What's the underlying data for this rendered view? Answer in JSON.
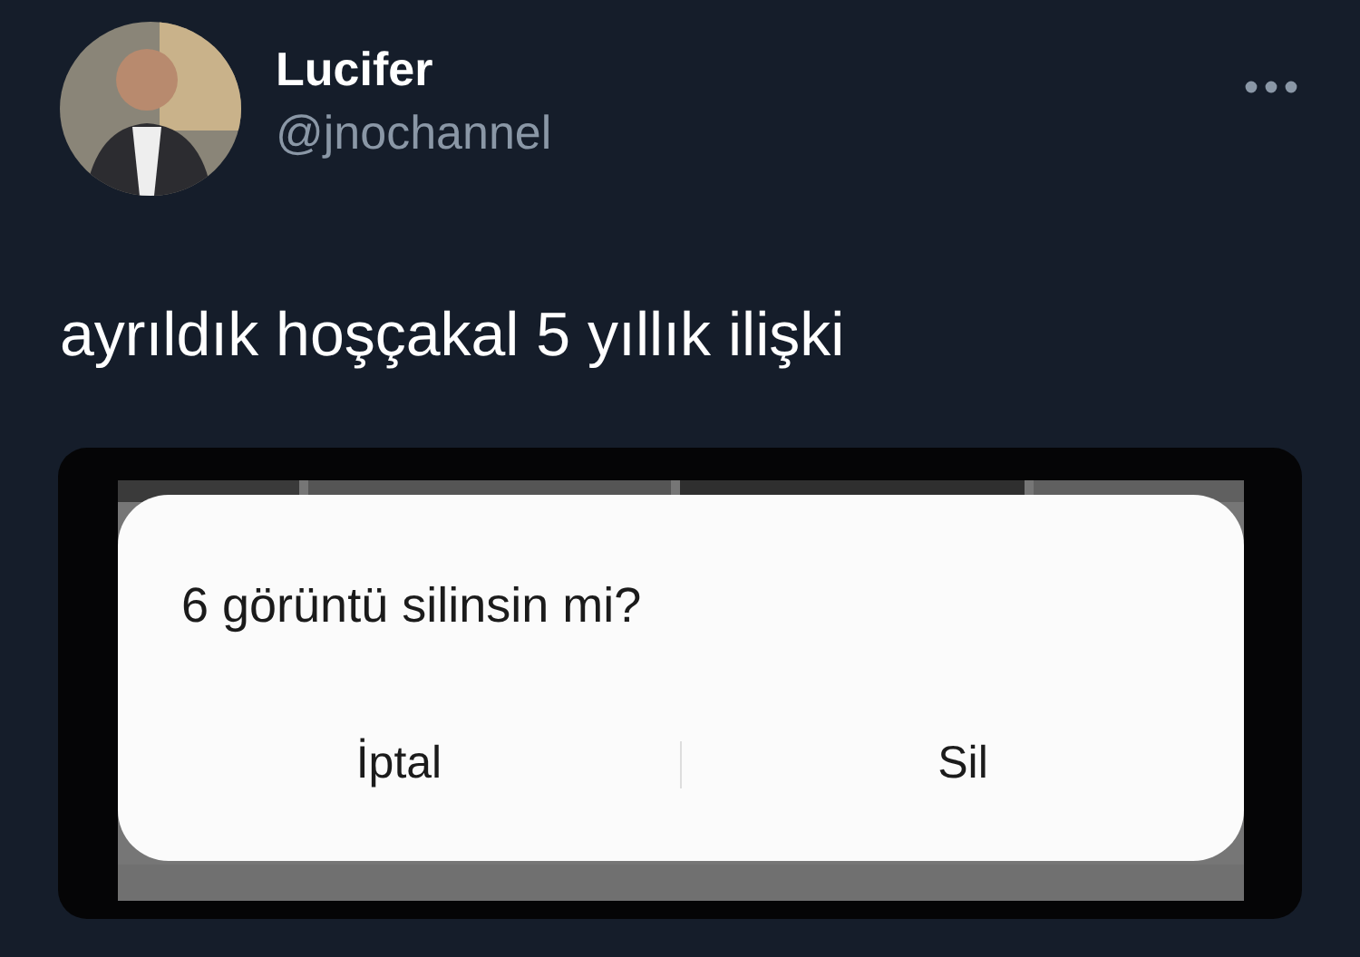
{
  "tweet": {
    "author_name": "Lucifer",
    "handle": "@jnochannel",
    "text": "ayrıldık hoşçakal 5 yıllık ilişki"
  },
  "media": {
    "dialog": {
      "title": "6 görüntü silinsin mi?",
      "buttons": [
        "İptal",
        "Sil"
      ]
    }
  }
}
